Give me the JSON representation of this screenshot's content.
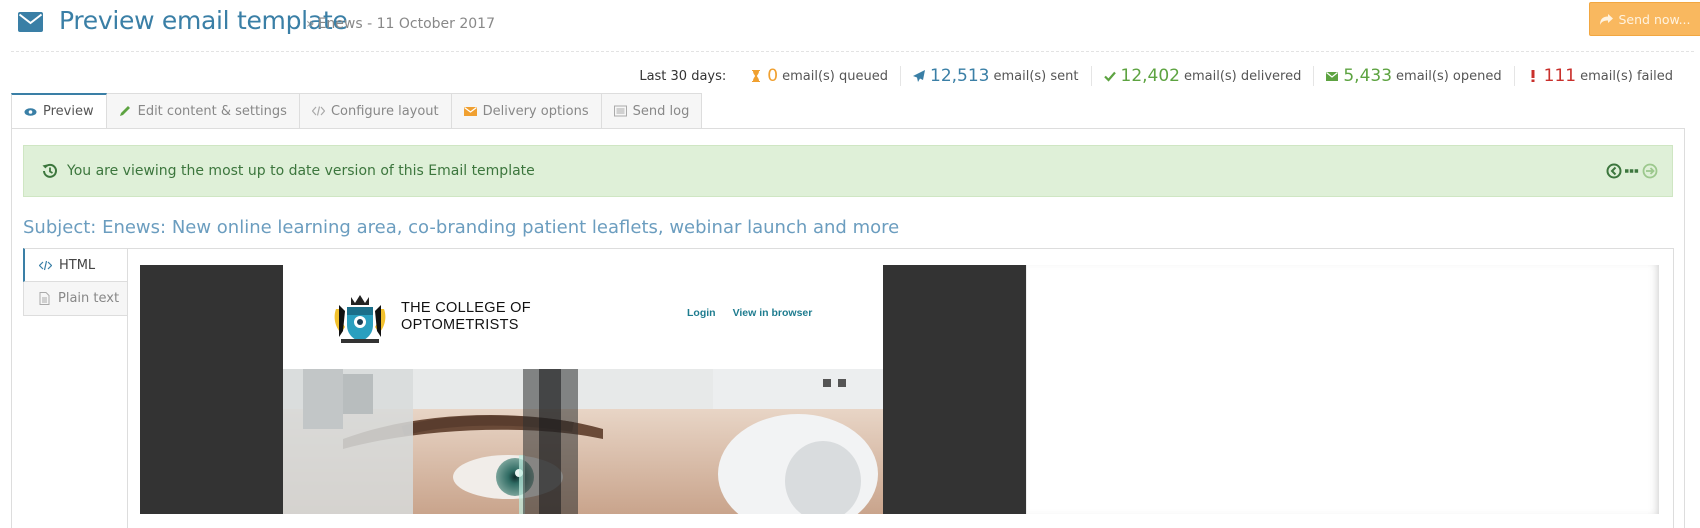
{
  "header": {
    "title": "Preview email template",
    "breadcrumb": "Enews - 11 October 2017",
    "send_label": "Send now..."
  },
  "stats": {
    "period": "Last 30 days:",
    "items": [
      {
        "icon": "hourglass-icon",
        "value": "0",
        "label": "email(s) queued",
        "color": "#f0a030"
      },
      {
        "icon": "paper-plane-icon",
        "value": "12,513",
        "label": "email(s) sent",
        "color": "#3a7fa6"
      },
      {
        "icon": "check-icon",
        "value": "12,402",
        "label": "email(s) delivered",
        "color": "#5da341"
      },
      {
        "icon": "envelope-open-icon",
        "value": "5,433",
        "label": "email(s) opened",
        "color": "#5da341"
      },
      {
        "icon": "exclamation-icon",
        "value": "111",
        "label": "email(s) failed",
        "color": "#c9302c"
      }
    ]
  },
  "tabs": [
    {
      "label": "Preview",
      "icon": "eye-icon",
      "active": true
    },
    {
      "label": "Edit content & settings",
      "icon": "pencil-icon"
    },
    {
      "label": "Configure layout",
      "icon": "code-icon"
    },
    {
      "label": "Delivery options",
      "icon": "envelope-icon"
    },
    {
      "label": "Send log",
      "icon": "list-icon"
    }
  ],
  "alert": {
    "text": "You are viewing the most up to date version of this Email template"
  },
  "subject": "Subject: Enews: New online learning area, co-branding patient leaflets, webinar launch and more",
  "format_tabs": [
    {
      "label": "HTML",
      "icon": "code-icon",
      "active": true
    },
    {
      "label": "Plain text",
      "icon": "file-icon"
    }
  ],
  "email": {
    "brand_line1": "THE COLLEGE OF",
    "brand_line2": "OPTOMETRISTS",
    "link_login": "Login",
    "link_browser": "View in browser"
  },
  "colors": {
    "accent": "#3a7fa6",
    "send_button": "#f9b85f",
    "alert_bg": "#dff0d8",
    "alert_text": "#3c763d"
  }
}
